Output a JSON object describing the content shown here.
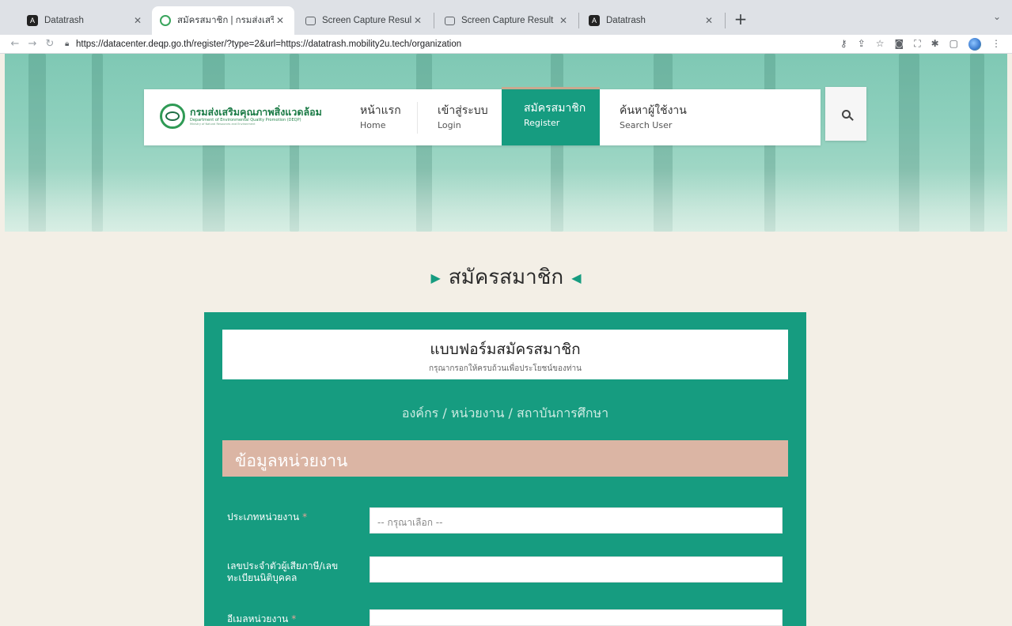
{
  "browser": {
    "tabs": [
      {
        "title": "Datatrash",
        "icon": "angular-icon",
        "close": "✕"
      },
      {
        "title": "สมัครสมาชิก | กรมส่งเสริมคุณภาพ",
        "icon": "deqp-seal-icon",
        "close": "✕"
      },
      {
        "title": "Screen Capture Result",
        "icon": "camera-icon",
        "close": "✕"
      },
      {
        "title": "Screen Capture Result",
        "icon": "camera-icon",
        "close": "✕"
      },
      {
        "title": "Datatrash",
        "icon": "angular-icon",
        "close": "✕"
      }
    ],
    "new_tab": "+",
    "tab_menu": "⌄",
    "url": "https://datacenter.deqp.go.th/register/?type=2&url=https://datatrash.mobility2u.tech/organization"
  },
  "site": {
    "logo": {
      "th": "กรมส่งเสริมคุณภาพสิ่งแวดล้อม",
      "en": "Department of Environmental Quality Promotion (DEQP)",
      "sub": "Ministry of Natural Resources and Environment"
    },
    "menu": [
      {
        "th": "หน้าแรก",
        "en": "Home"
      },
      {
        "th": "เข้าสู่ระบบ",
        "en": "Login"
      },
      {
        "th": "สมัครสมาชิก",
        "en": "Register"
      },
      {
        "th": "ค้นหาผู้ใช้งาน",
        "en": "Search User"
      }
    ]
  },
  "page": {
    "title": "สมัครสมาชิก",
    "form_title": "แบบฟอร์มสมัครสมาชิก",
    "form_subtitle": "กรุณากรอกให้ครบถ้วนเพื่อประโยชน์ของท่าน",
    "org_type": "องค์กร / หน่วยงาน / สถาบันการศึกษา",
    "section": "ข้อมูลหน่วยงาน",
    "fields": [
      {
        "label": "ประเภทหน่วยงาน",
        "required": "*",
        "value": "-- กรุณาเลือก --"
      },
      {
        "label": "เลขประจำตัวผู้เสียภาษี/เลขทะเบียนนิติบุคคล",
        "required": "",
        "value": ""
      },
      {
        "label": "อีเมลหน่วยงาน",
        "required": "*",
        "value": ""
      }
    ]
  },
  "colors": {
    "primary": "#169c80",
    "section": "#dbb5a4",
    "nav_active_border": "#c9a98f"
  }
}
